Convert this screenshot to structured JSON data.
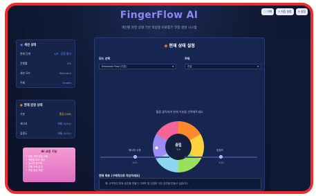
{
  "header": {
    "title": "FingerFlow AI",
    "subtitle": "개인별 감정 상태 기반 적응형 미로찾기 코칭 생성 시스템",
    "buttons": [
      "이해",
      "처음 설정",
      "설정"
    ]
  },
  "status_card": {
    "title": "세션 상태",
    "rows": [
      {
        "key": "현재 단계",
        "value": "1/5 · 감정 평가"
      },
      {
        "key": "진행률",
        "value": "0%"
      },
      {
        "key": "세션 모드",
        "value": "Standard"
      },
      {
        "key": "주제",
        "value": "Health"
      }
    ]
  },
  "emotion_card": {
    "title": "현재 감정 상태",
    "rows": [
      {
        "key": "기분",
        "value": "중립 (5/8)"
      },
      {
        "key": "에너지",
        "value": "보통 (5/10)"
      },
      {
        "key": "집중도",
        "value": "보통 (5/10)"
      }
    ]
  },
  "promo": {
    "title": "AI 코칭 기능",
    "items": [
      "감정 기반 맞춤 코칭",
      "적응형 미로 생성",
      "실시간 피드백",
      "진행 추적 분석",
      "목표 달성 지원"
    ]
  },
  "main": {
    "title": "현재 상태 설정",
    "mode_label": "모드 선택",
    "mode_value": "Standard Flow (기본)",
    "theme_label": "주제",
    "theme_value": "건강",
    "hint": "휠을 클릭하여 현재 기분을 선택해주세요",
    "wheel_center_label": "중립",
    "wheel_center_value": "5/8",
    "energy_label": "에너지 수준",
    "energy_value": "5/10",
    "focus_label": "집중도",
    "focus_value": "5/10",
    "goal_label": "현재 목표 (구체적으로 작성하세요)",
    "goal_placeholder": "예: 규칙적인 운동 습관을 만들기 그래프 및 건강한 식단 습관을 만들고 싶습니다."
  },
  "wheel_colors": [
    "#ff8a2b",
    "#ffd43b",
    "#98e05d",
    "#8dd6ef",
    "#9c8bf0",
    "#f7649a"
  ],
  "levels": {
    "energy": 0.5,
    "focus": 0.5
  }
}
